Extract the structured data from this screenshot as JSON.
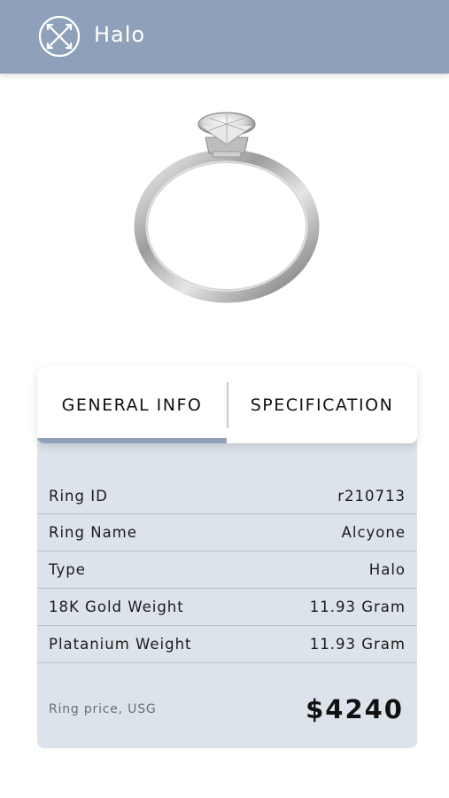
{
  "header": {
    "title": "Halo",
    "logo_icon": "crossed-tools-icon",
    "background": "#8fa1ba"
  },
  "product": {
    "image": "solitaire-ring-image"
  },
  "tabs": [
    {
      "label": "GENERAL INFO",
      "active": true
    },
    {
      "label": "SPECIFICATION",
      "active": false
    }
  ],
  "details": [
    {
      "label": "Ring ID",
      "value": "r210713"
    },
    {
      "label": "Ring Name",
      "value": "Alcyone"
    },
    {
      "label": "Type",
      "value": "Halo"
    },
    {
      "label": "18K Gold Weight",
      "value": "11.93 Gram"
    },
    {
      "label": "Platanium Weight",
      "value": "11.93 Gram"
    }
  ],
  "price": {
    "label": "Ring price, USG",
    "value": "$4240"
  },
  "colors": {
    "accent": "#8fa1ba",
    "card_bg": "#dde3eb"
  }
}
